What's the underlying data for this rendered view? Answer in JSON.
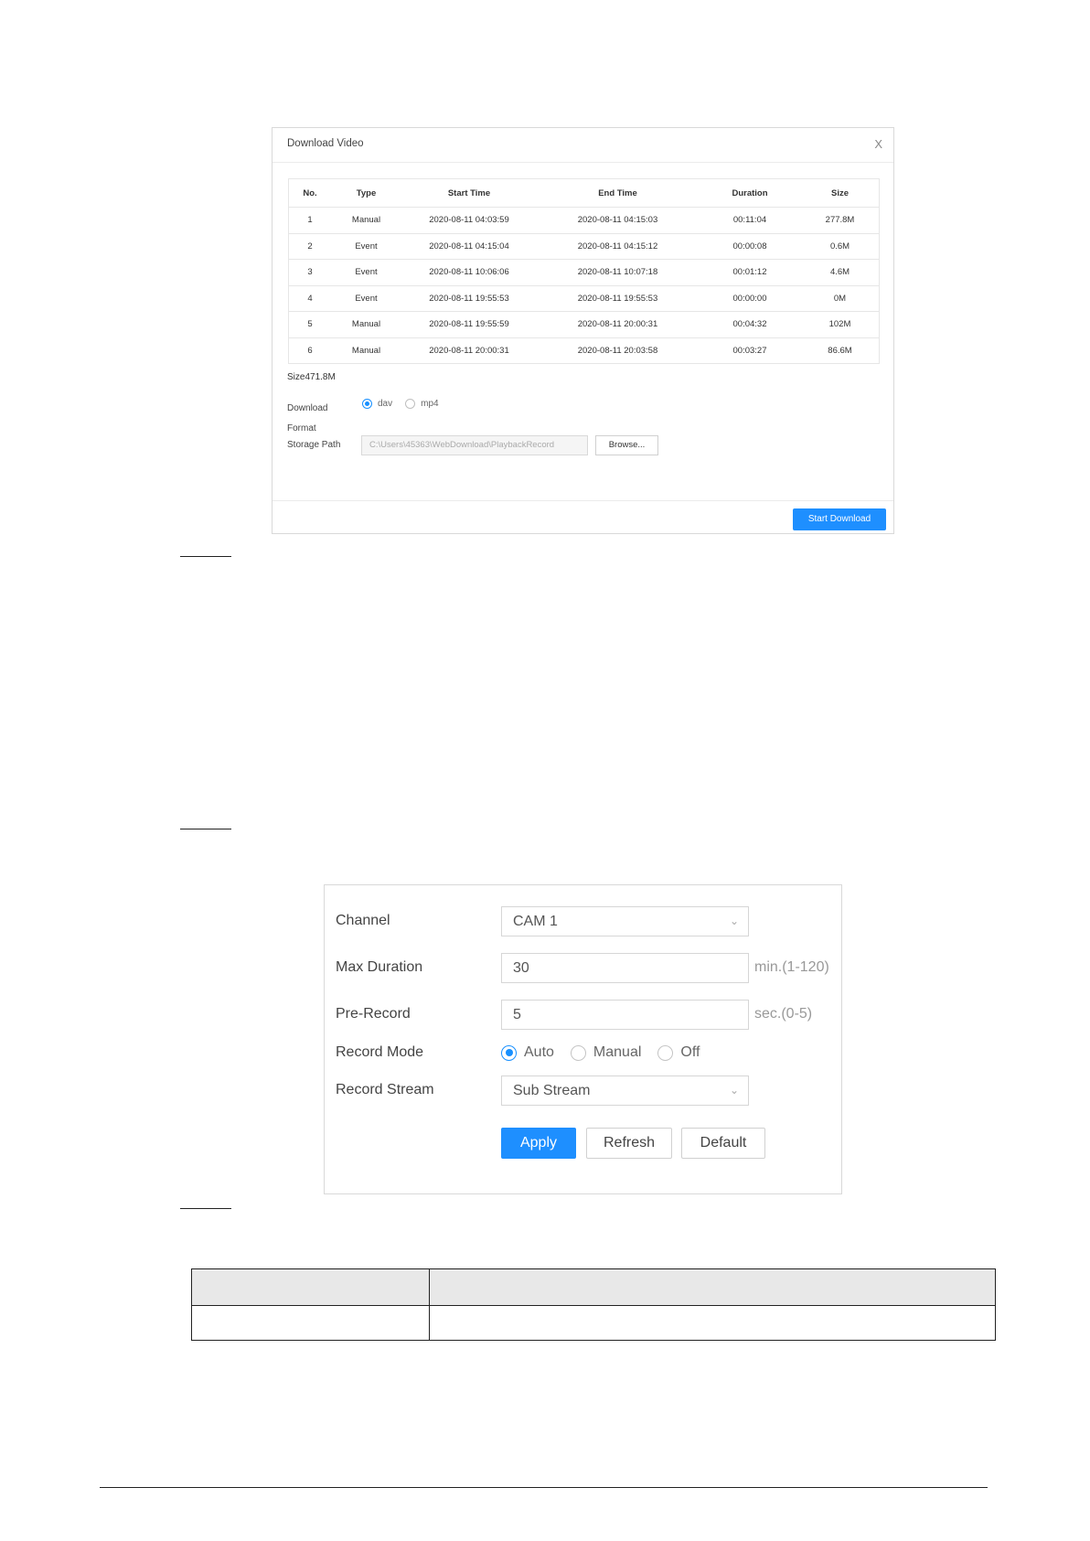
{
  "download_dialog": {
    "title": "Download Video",
    "close_glyph": "X",
    "columns": [
      "No.",
      "Type",
      "Start Time",
      "End Time",
      "Duration",
      "Size"
    ],
    "rows": [
      [
        "1",
        "Manual",
        "2020-08-11 04:03:59",
        "2020-08-11 04:15:03",
        "00:11:04",
        "277.8M"
      ],
      [
        "2",
        "Event",
        "2020-08-11 04:15:04",
        "2020-08-11 04:15:12",
        "00:00:08",
        "0.6M"
      ],
      [
        "3",
        "Event",
        "2020-08-11 10:06:06",
        "2020-08-11 10:07:18",
        "00:01:12",
        "4.6M"
      ],
      [
        "4",
        "Event",
        "2020-08-11 19:55:53",
        "2020-08-11 19:55:53",
        "00:00:00",
        "0M"
      ],
      [
        "5",
        "Manual",
        "2020-08-11 19:55:59",
        "2020-08-11 20:00:31",
        "00:04:32",
        "102M"
      ],
      [
        "6",
        "Manual",
        "2020-08-11 20:00:31",
        "2020-08-11 20:03:58",
        "00:03:27",
        "86.6M"
      ]
    ],
    "size_text": "Size471.8M",
    "format_label": "Download Format",
    "format_options": [
      {
        "label": "dav",
        "selected": true
      },
      {
        "label": "mp4",
        "selected": false
      }
    ],
    "storage_path_label": "Storage Path",
    "storage_path_value": "C:\\Users\\45363\\WebDownload\\PlaybackRecord",
    "browse_label": "Browse...",
    "start_download_label": "Start Download"
  },
  "record_form": {
    "channel_label": "Channel",
    "channel_value": "CAM 1",
    "max_duration_label": "Max Duration",
    "max_duration_value": "30",
    "max_duration_unit": "min.(1-120)",
    "pre_record_label": "Pre-Record",
    "pre_record_value": "5",
    "pre_record_unit": "sec.(0-5)",
    "record_mode_label": "Record Mode",
    "record_mode_options": [
      {
        "label": "Auto",
        "selected": true
      },
      {
        "label": "Manual",
        "selected": false
      },
      {
        "label": "Off",
        "selected": false
      }
    ],
    "record_stream_label": "Record Stream",
    "record_stream_value": "Sub Stream",
    "apply_label": "Apply",
    "refresh_label": "Refresh",
    "default_label": "Default"
  },
  "colors": {
    "accent": "#1e8fff",
    "table_header_bg": "#e8e8e8"
  }
}
